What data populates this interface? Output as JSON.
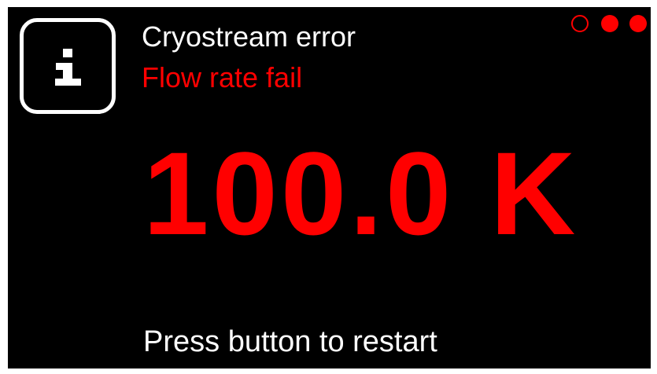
{
  "header": {
    "title": "Cryostream error",
    "subtitle": "Flow rate fail",
    "icon": "info-icon"
  },
  "status_indicator": {
    "dots": [
      {
        "state": "outline"
      },
      {
        "state": "filled"
      },
      {
        "state": "filled"
      }
    ]
  },
  "reading": {
    "value": "100.0 K"
  },
  "footer": {
    "prompt": "Press button to restart"
  },
  "colors": {
    "background": "#000000",
    "text": "#ffffff",
    "alert": "#ff0000"
  }
}
